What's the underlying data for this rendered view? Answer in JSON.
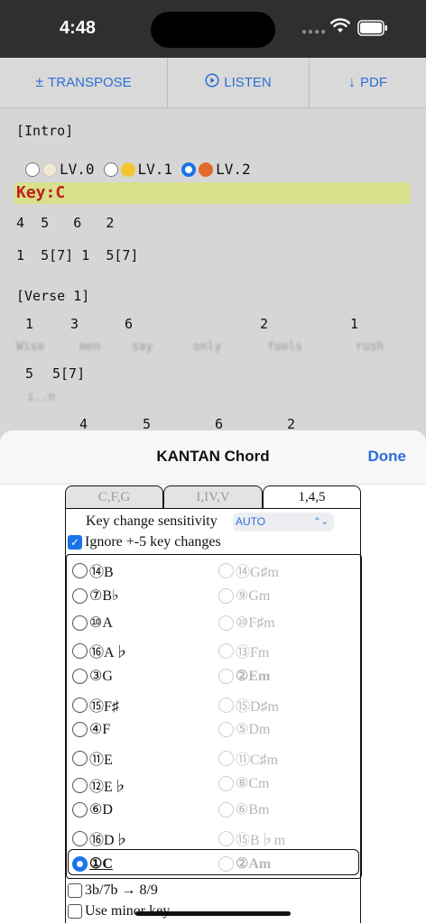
{
  "status": {
    "time": "4:48"
  },
  "toolbar": {
    "transpose": {
      "icon": "±",
      "label": "TRANSPOSE"
    },
    "listen": {
      "icon": "▶",
      "label": "LISTEN"
    },
    "pdf": {
      "icon": "↓",
      "label": "PDF"
    }
  },
  "sheet": {
    "intro": "[Intro]",
    "levels": [
      {
        "label": "LV.0",
        "selected": false,
        "icon": "egg-icon"
      },
      {
        "label": "LV.1",
        "selected": false,
        "icon": "chick-icon"
      },
      {
        "label": "LV.2",
        "selected": true,
        "icon": "chicken-icon"
      }
    ],
    "key": "Key:C",
    "intro_rows": [
      "4  5   6   2",
      "1  5[7] 1  5[7]"
    ],
    "verse": "[Verse 1]",
    "verse_chords_1": [
      "1",
      "3",
      "6",
      "2",
      "1"
    ],
    "verse_lyrics_1": [
      "Wise",
      "men",
      "say",
      "only",
      "fools",
      "rush"
    ],
    "verse_chords_2": [
      "5",
      "5[7]"
    ],
    "verse_lyrics_2": [
      "i..n"
    ],
    "verse_chords_3": [
      "4",
      "5",
      "6",
      "2"
    ]
  },
  "modal": {
    "title": "KANTAN Chord",
    "done": "Done",
    "tabs": [
      "C,F,G",
      "I,IV,V",
      "1,4,5"
    ],
    "active_tab": 2,
    "sensitivity_label": "Key change sensitivity",
    "sensitivity_value": "AUTO",
    "ignore_label": "Ignore +-5 key changes",
    "ignore_checked": true,
    "keys": [
      {
        "major": "⑭B",
        "minor": "⑭G♯m"
      },
      {
        "major": "⑦B♭",
        "minor": "⑨Gm"
      },
      {
        "major": "⑩A",
        "minor": "⑩F♯m"
      },
      {
        "major": "⑯A♭",
        "minor": "⑬Fm"
      },
      {
        "major": "③G",
        "minor": "②Em"
      },
      {
        "major": "⑮F♯",
        "minor": "⑮D♯m"
      },
      {
        "major": "④F",
        "minor": "⑤Dm"
      },
      {
        "major": "⑪E",
        "minor": "⑪C♯m"
      },
      {
        "major": "⑫E♭",
        "minor": "⑧Cm"
      },
      {
        "major": "⑥D",
        "minor": "⑥Bm"
      },
      {
        "major": "⑯D♭",
        "minor": "⑮B♭m"
      },
      {
        "major": "①C",
        "minor": "②Am"
      }
    ],
    "selected_key": "①C",
    "option1": "3b/7b → 8/9",
    "option2": "Use minor key"
  }
}
